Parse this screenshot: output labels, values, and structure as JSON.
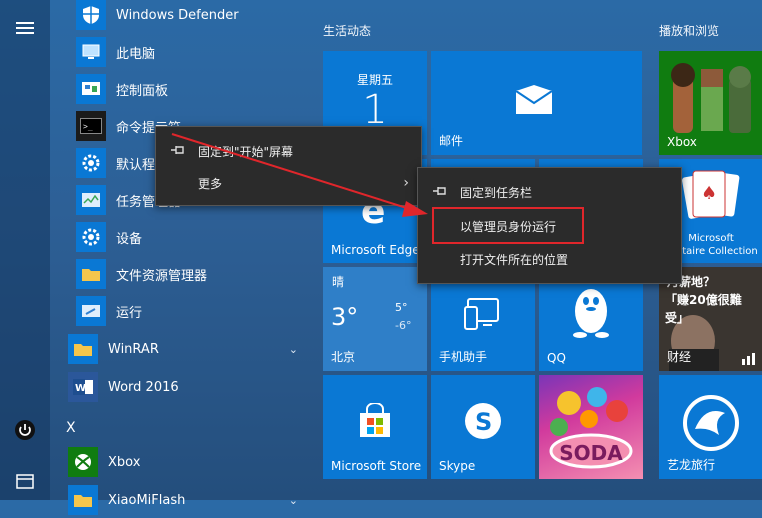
{
  "rail": {
    "items": [
      {
        "icon": "hamburger-icon"
      },
      {
        "icon": "power-icon"
      },
      {
        "icon": "file-explorer-icon"
      }
    ]
  },
  "apps": [
    {
      "label": "Windows Defender",
      "icon": "shield-icon",
      "color": "#0a78d4"
    },
    {
      "label": "此电脑",
      "icon": "computer-icon",
      "color": "#0a78d4"
    },
    {
      "label": "控制面板",
      "icon": "control-panel-icon",
      "color": "#0a78d4"
    },
    {
      "label": "命令提示符",
      "icon": "command-prompt-icon",
      "color": "#1b1b1b"
    },
    {
      "label": "默认程序",
      "icon": "gear-icon",
      "color": "#0a78d4"
    },
    {
      "label": "任务管理器",
      "icon": "task-manager-icon",
      "color": "#0a78d4"
    },
    {
      "label": "设备",
      "icon": "gear-icon",
      "color": "#0a78d4"
    },
    {
      "label": "文件资源管理器",
      "icon": "folder-icon",
      "color": "#0a78d4"
    },
    {
      "label": "运行",
      "icon": "run-icon",
      "color": "#0a78d4"
    },
    {
      "label": "WinRAR",
      "icon": "folder-icon",
      "color": "#0a78d4",
      "expand": true
    },
    {
      "label": "Word 2016",
      "icon": "word-icon",
      "color": "#2b579a"
    },
    {
      "label": "Xbox",
      "icon": "xbox-icon",
      "color": "#107c10"
    },
    {
      "label": "XiaoMiFlash",
      "icon": "folder-icon",
      "color": "#0a78d4",
      "expand": true
    }
  ],
  "letter_x": "X",
  "groups": {
    "life": "生活动态",
    "play": "播放和浏览"
  },
  "tiles": {
    "calendar": {
      "day": "星期五",
      "date": "1"
    },
    "mail": {
      "label": "邮件"
    },
    "edge": {
      "label": "Microsoft Edge"
    },
    "weather": {
      "cond": "晴",
      "temp": "3°",
      "high": "5°",
      "low": "-6°",
      "city": "北京"
    },
    "phone": {
      "label": "手机助手"
    },
    "qq": {
      "label": "QQ"
    },
    "store": {
      "label": "Microsoft Store"
    },
    "skype": {
      "label": "Skype"
    },
    "candy": {
      "label": "SODA"
    },
    "yilong": {
      "label": "艺龙旅行"
    },
    "xbox": {
      "label": "Xbox"
    },
    "solitaire": {
      "label1": "Microsoft",
      "label2": "Solitaire Collection"
    },
    "finance": {
      "headline1": "月薪地？",
      "headline2": "「赚20億很難",
      "headline3": "受」",
      "label": "财经"
    }
  },
  "context_menu": {
    "pin_start": "固定到\"开始\"屏幕",
    "more": "更多"
  },
  "submenu": {
    "pin_taskbar": "固定到任务栏",
    "run_admin": "以管理员身份运行",
    "open_location": "打开文件所在的位置"
  },
  "colors": {
    "highlight": "#e0262b",
    "tile_blue": "#0a78d4"
  }
}
